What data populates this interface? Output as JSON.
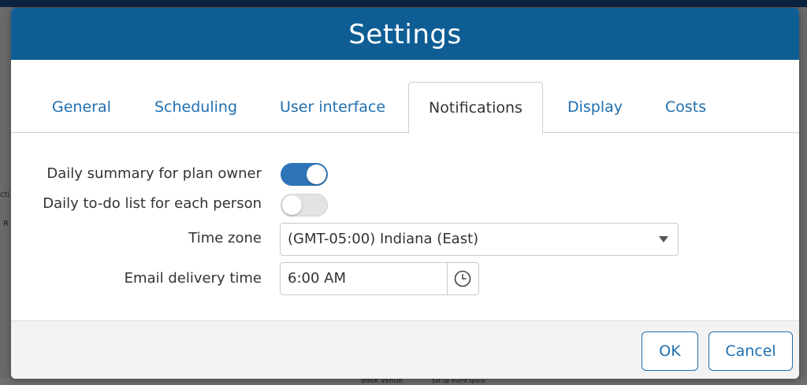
{
  "background": {
    "fragments": [
      "cti",
      "R",
      "Book venue",
      "Set up event space"
    ]
  },
  "modal": {
    "title": "Settings",
    "tabs": [
      {
        "label": "General",
        "active": false
      },
      {
        "label": "Scheduling",
        "active": false
      },
      {
        "label": "User interface",
        "active": false
      },
      {
        "label": "Notifications",
        "active": true
      },
      {
        "label": "Display",
        "active": false
      },
      {
        "label": "Costs",
        "active": false
      }
    ],
    "form": {
      "daily_summary": {
        "label": "Daily summary for plan owner",
        "checked": true
      },
      "daily_todo": {
        "label": "Daily to-do list for each person",
        "checked": false
      },
      "time_zone": {
        "label": "Time zone",
        "value": "(GMT-05:00) Indiana (East)"
      },
      "email_time": {
        "label": "Email delivery time",
        "value": "6:00 AM",
        "icon": "clock-icon"
      }
    },
    "buttons": {
      "ok": "OK",
      "cancel": "Cancel"
    }
  },
  "colors": {
    "header": "#0e5e95",
    "accent": "#2f74b8",
    "link": "#1f6fb0"
  }
}
